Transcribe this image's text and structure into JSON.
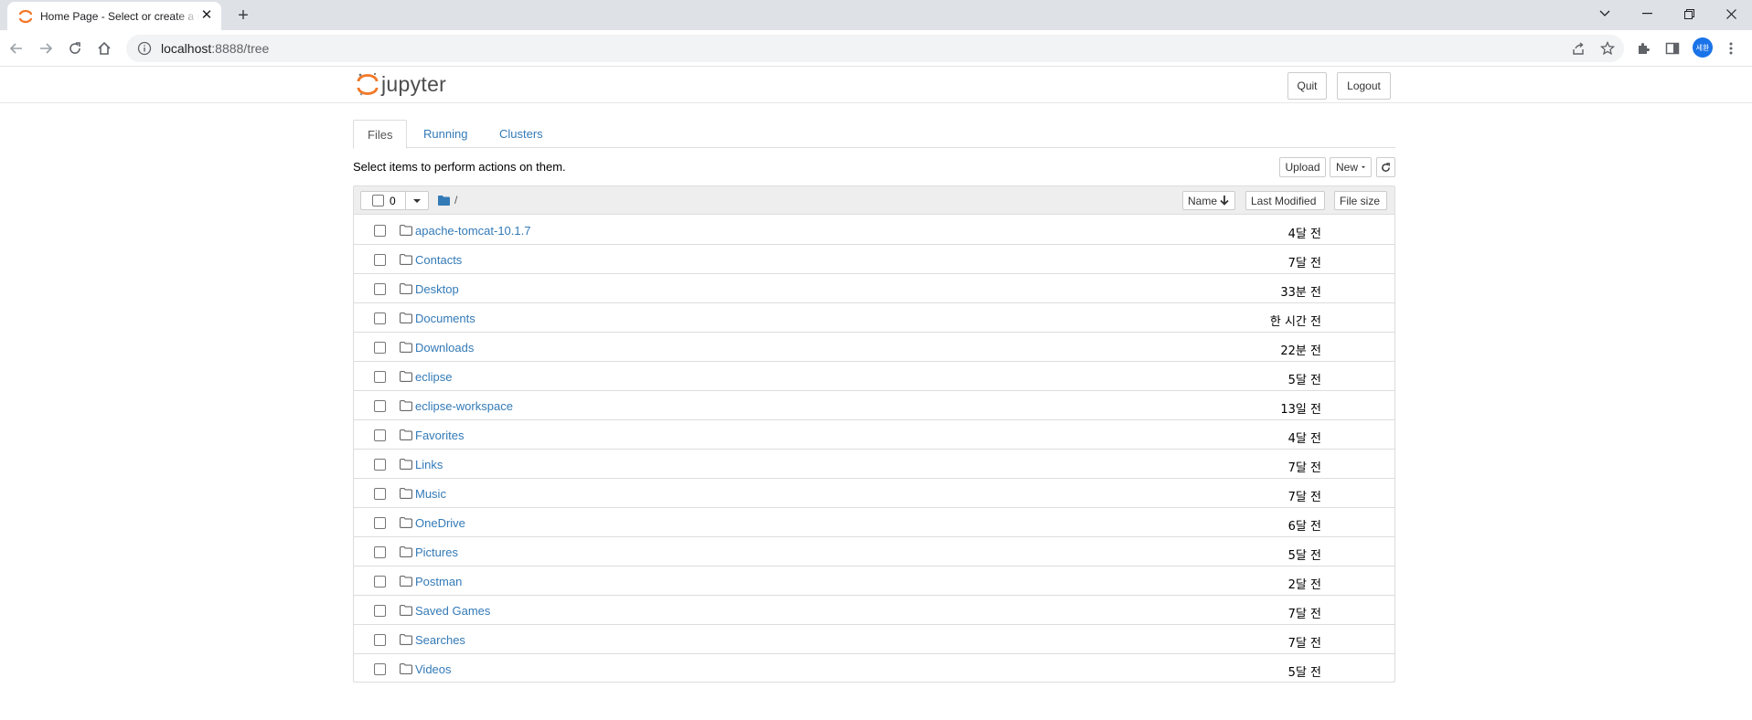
{
  "browser": {
    "tab_title": "Home Page - Select or create a notebook",
    "new_tab": "+",
    "url_host": "localhost",
    "url_rest": ":8888/tree",
    "profile_initials": "세환",
    "accent": "#1a73e8"
  },
  "header": {
    "logo_text": "jupyter",
    "quit_label": "Quit",
    "logout_label": "Logout"
  },
  "tabs": [
    {
      "label": "Files",
      "active": true
    },
    {
      "label": "Running",
      "active": false
    },
    {
      "label": "Clusters",
      "active": false
    }
  ],
  "toolbar": {
    "hint": "Select items to perform actions on them.",
    "upload_label": "Upload",
    "new_label": "New"
  },
  "list_header": {
    "selected_count": "0",
    "breadcrumb": "/",
    "name_label": "Name",
    "last_modified_label": "Last Modified",
    "file_size_label": "File size"
  },
  "files": [
    {
      "name": "apache-tomcat-10.1.7",
      "modified": "4달 전"
    },
    {
      "name": "Contacts",
      "modified": "7달 전"
    },
    {
      "name": "Desktop",
      "modified": "33분 전"
    },
    {
      "name": "Documents",
      "modified": "한 시간 전"
    },
    {
      "name": "Downloads",
      "modified": "22분 전"
    },
    {
      "name": "eclipse",
      "modified": "5달 전"
    },
    {
      "name": "eclipse-workspace",
      "modified": "13일 전"
    },
    {
      "name": "Favorites",
      "modified": "4달 전"
    },
    {
      "name": "Links",
      "modified": "7달 전"
    },
    {
      "name": "Music",
      "modified": "7달 전"
    },
    {
      "name": "OneDrive",
      "modified": "6달 전"
    },
    {
      "name": "Pictures",
      "modified": "5달 전"
    },
    {
      "name": "Postman",
      "modified": "2달 전"
    },
    {
      "name": "Saved Games",
      "modified": "7달 전"
    },
    {
      "name": "Searches",
      "modified": "7달 전"
    },
    {
      "name": "Videos",
      "modified": "5달 전"
    }
  ],
  "colors": {
    "link": "#337ab7",
    "jupyter_orange": "#f37726"
  }
}
